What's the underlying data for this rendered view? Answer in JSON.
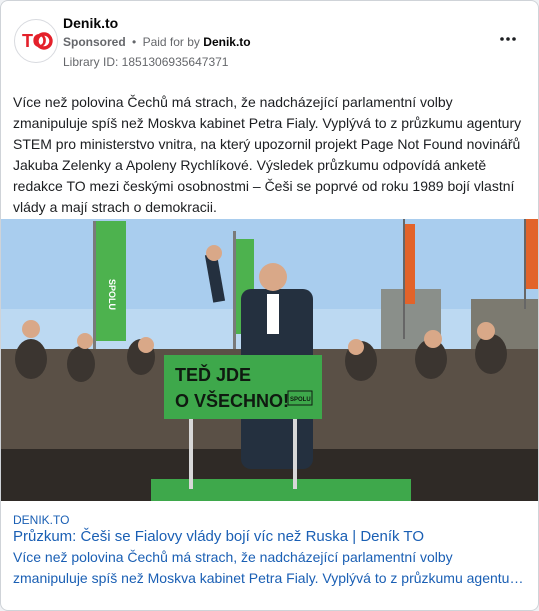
{
  "advertiser": {
    "name": "Denik.to",
    "sponsored_label": "Sponsored",
    "dot": "•",
    "paid_for_prefix": "Paid for by",
    "paid_for_name": "Denik.to",
    "library_id": "Library ID: 1851306935647371",
    "logo_text": "TO",
    "logo_color": "#e4202a"
  },
  "post": {
    "text": "Více než polovina Čechů má strach, že nadcházející parlamentní volby zmanipuluje spíš než Moskva kabinet Petra Fialy. Vyplývá to z průzkumu agentury STEM pro ministerstvo vnitra, na který upozornil projekt Page Not Found novinářů Jakuba Zelenky a Apoleny Rychlíkové. Výsledek průzkumu odpovídá anketě redakce TO mezi českými osobnostmi – Češi se poprvé od roku 1989 bojí vlastní vlády a mají strach o demokracii."
  },
  "image": {
    "banner_line1": "TEĎ JDE",
    "banner_line2": "O VŠECHNO!",
    "banner_logo": "SPOLU",
    "banner_color": "#3ea84b",
    "flag_text": "SPOLU",
    "flag_color": "#4db24e",
    "sky_color": "#bcd9f2"
  },
  "link": {
    "domain": "DENIK.TO",
    "title": "Průzkum: Češi se Fialovy vlády bojí víc než Ruska | Deník TO",
    "description": "Více než polovina Čechů má strach, že nadcházející parlamentní volby zmanipuluje spíš než Moskva kabinet Petra Fialy. Vyplývá to z průzkumu agentury STEM pro ministerstvo vnitra, na který upozornil projekt Page Not Found novinářů Jakuba Zelenky a Apoleny Rychlíkové.",
    "color": "#1a5fb4"
  },
  "icons": {
    "more": "more-horizontal-icon"
  }
}
